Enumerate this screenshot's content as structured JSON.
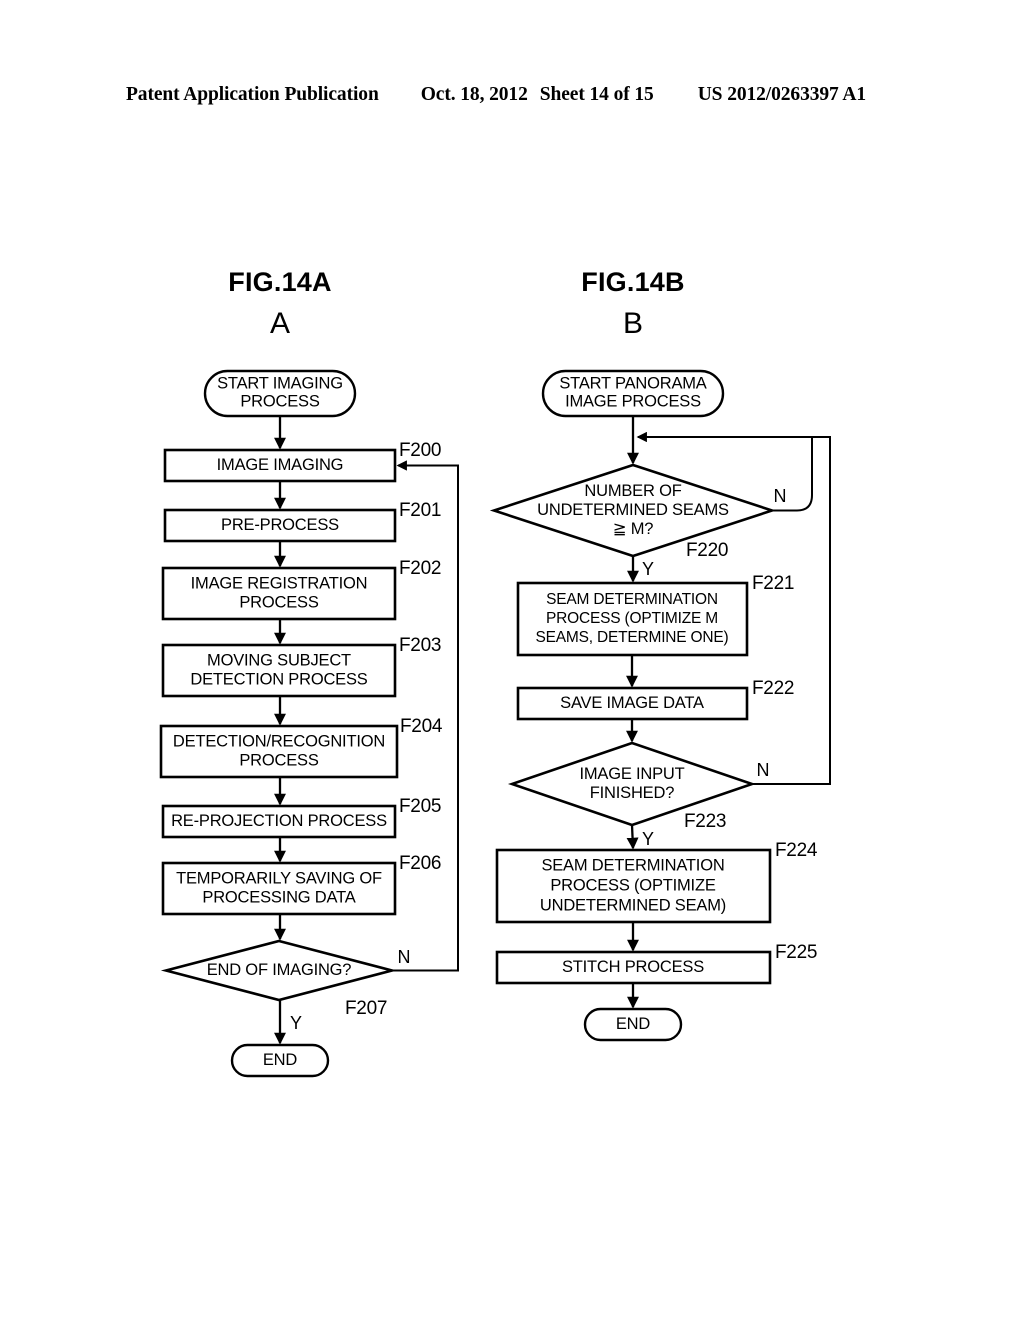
{
  "header": {
    "publication_title": "Patent Application Publication",
    "publication_date": "Oct. 18, 2012",
    "sheet": "Sheet 14 of 15",
    "publication_number": "US 2012/0263397 A1"
  },
  "figures": [
    {
      "id": "fig-14a",
      "caption": "FIG.14A",
      "letter": "A",
      "nodes": {
        "start": "START IMAGING\nPROCESS",
        "f200": "IMAGE IMAGING",
        "f201": "PRE-PROCESS",
        "f202": "IMAGE REGISTRATION\nPROCESS",
        "f203": "MOVING SUBJECT\nDETECTION PROCESS",
        "f204": "DETECTION/RECOGNITION\nPROCESS",
        "f205": "RE-PROJECTION PROCESS",
        "f206": "TEMPORARILY SAVING OF\nPROCESSING DATA",
        "f207": "END OF IMAGING?",
        "end": "END"
      },
      "step_labels": {
        "f200": "F200",
        "f201": "F201",
        "f202": "F202",
        "f203": "F203",
        "f204": "F204",
        "f205": "F205",
        "f206": "F206",
        "f207": "F207"
      },
      "branch_labels": {
        "f207_no": "N",
        "f207_yes": "Y"
      }
    },
    {
      "id": "fig-14b",
      "caption": "FIG.14B",
      "letter": "B",
      "nodes": {
        "start": "START PANORAMA\nIMAGE PROCESS",
        "f220": "NUMBER OF\nUNDETERMINED SEAMS\n≧ M?",
        "f221": "SEAM DETERMINATION\nPROCESS (OPTIMIZE M\nSEAMS, DETERMINE ONE)",
        "f222": "SAVE IMAGE DATA",
        "f223": "IMAGE INPUT\nFINISHED?",
        "f224": "SEAM DETERMINATION\nPROCESS (OPTIMIZE\nUNDETERMINED SEAM)",
        "f225": "STITCH PROCESS",
        "end": "END"
      },
      "step_labels": {
        "f220": "F220",
        "f221": "F221",
        "f222": "F222",
        "f223": "F223",
        "f224": "F224",
        "f225": "F225"
      },
      "branch_labels": {
        "f220_no": "N",
        "f220_yes": "Y",
        "f223_no": "N",
        "f223_yes": "Y"
      }
    }
  ],
  "colors": {
    "ink": "#000000",
    "paper": "#ffffff"
  }
}
